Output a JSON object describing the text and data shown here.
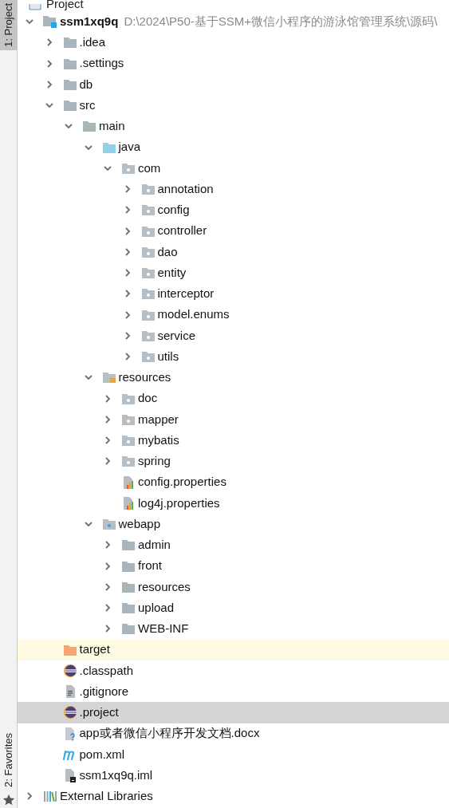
{
  "side_tabs": [
    {
      "label": "1: Project",
      "selected": true
    },
    {
      "label": "2: Favorites",
      "selected": false
    }
  ],
  "header": {
    "title": "Project"
  },
  "tree": [
    {
      "name": "ssm1xq9q",
      "path": "D:\\2024\\P50-基于SSM+微信小程序的游泳馆管理系统\\源码\\",
      "kind": "module",
      "expanded": true,
      "selected": false,
      "children": [
        {
          "name": ".idea",
          "kind": "folder",
          "expanded": false,
          "selected": false
        },
        {
          "name": ".settings",
          "kind": "folder",
          "expanded": false,
          "selected": false
        },
        {
          "name": "db",
          "kind": "folder",
          "expanded": false,
          "selected": false
        },
        {
          "name": "src",
          "kind": "folder",
          "expanded": true,
          "selected": false,
          "children": [
            {
              "name": "main",
              "kind": "folder",
              "expanded": true,
              "selected": false,
              "children": [
                {
                  "name": "java",
                  "kind": "source",
                  "expanded": true,
                  "selected": false,
                  "children": [
                    {
                      "name": "com",
                      "kind": "package",
                      "expanded": true,
                      "selected": false,
                      "children": [
                        {
                          "name": "annotation",
                          "kind": "package",
                          "expanded": false,
                          "selected": false
                        },
                        {
                          "name": "config",
                          "kind": "package",
                          "expanded": false,
                          "selected": false
                        },
                        {
                          "name": "controller",
                          "kind": "package",
                          "expanded": false,
                          "selected": false
                        },
                        {
                          "name": "dao",
                          "kind": "package",
                          "expanded": false,
                          "selected": false
                        },
                        {
                          "name": "entity",
                          "kind": "package",
                          "expanded": false,
                          "selected": false
                        },
                        {
                          "name": "interceptor",
                          "kind": "package",
                          "expanded": false,
                          "selected": false
                        },
                        {
                          "name": "model.enums",
                          "kind": "package",
                          "expanded": false,
                          "selected": false
                        },
                        {
                          "name": "service",
                          "kind": "package",
                          "expanded": false,
                          "selected": false
                        },
                        {
                          "name": "utils",
                          "kind": "package",
                          "expanded": false,
                          "selected": false
                        }
                      ]
                    }
                  ]
                },
                {
                  "name": "resources",
                  "kind": "resources",
                  "expanded": true,
                  "selected": false,
                  "children": [
                    {
                      "name": "doc",
                      "kind": "package",
                      "expanded": false,
                      "selected": false
                    },
                    {
                      "name": "mapper",
                      "kind": "package",
                      "expanded": false,
                      "selected": false
                    },
                    {
                      "name": "mybatis",
                      "kind": "package",
                      "expanded": false,
                      "selected": false
                    },
                    {
                      "name": "spring",
                      "kind": "package",
                      "expanded": false,
                      "selected": false
                    },
                    {
                      "name": "config.properties",
                      "kind": "properties",
                      "selected": false
                    },
                    {
                      "name": "log4j.properties",
                      "kind": "properties",
                      "selected": false
                    }
                  ]
                },
                {
                  "name": "webapp",
                  "kind": "web",
                  "expanded": true,
                  "selected": false,
                  "children": [
                    {
                      "name": "admin",
                      "kind": "folder",
                      "expanded": false,
                      "selected": false
                    },
                    {
                      "name": "front",
                      "kind": "folder",
                      "expanded": false,
                      "selected": false
                    },
                    {
                      "name": "resources",
                      "kind": "folder",
                      "expanded": false,
                      "selected": false
                    },
                    {
                      "name": "upload",
                      "kind": "folder",
                      "expanded": false,
                      "selected": false
                    },
                    {
                      "name": "WEB-INF",
                      "kind": "folder",
                      "expanded": false,
                      "selected": false
                    }
                  ]
                }
              ]
            }
          ]
        },
        {
          "name": "target",
          "kind": "excluded",
          "selected": false
        },
        {
          "name": ".classpath",
          "kind": "eclipse",
          "selected": false
        },
        {
          "name": ".gitignore",
          "kind": "text",
          "selected": false
        },
        {
          "name": ".project",
          "kind": "eclipse",
          "selected": true
        },
        {
          "name": "app或者微信小程序开发文档.docx",
          "kind": "unknown",
          "selected": false
        },
        {
          "name": "pom.xml",
          "kind": "maven",
          "selected": false
        },
        {
          "name": "ssm1xq9q.iml",
          "kind": "iml",
          "selected": false
        }
      ]
    },
    {
      "name": "External Libraries",
      "kind": "libraries",
      "expanded": false,
      "selected": false
    }
  ]
}
